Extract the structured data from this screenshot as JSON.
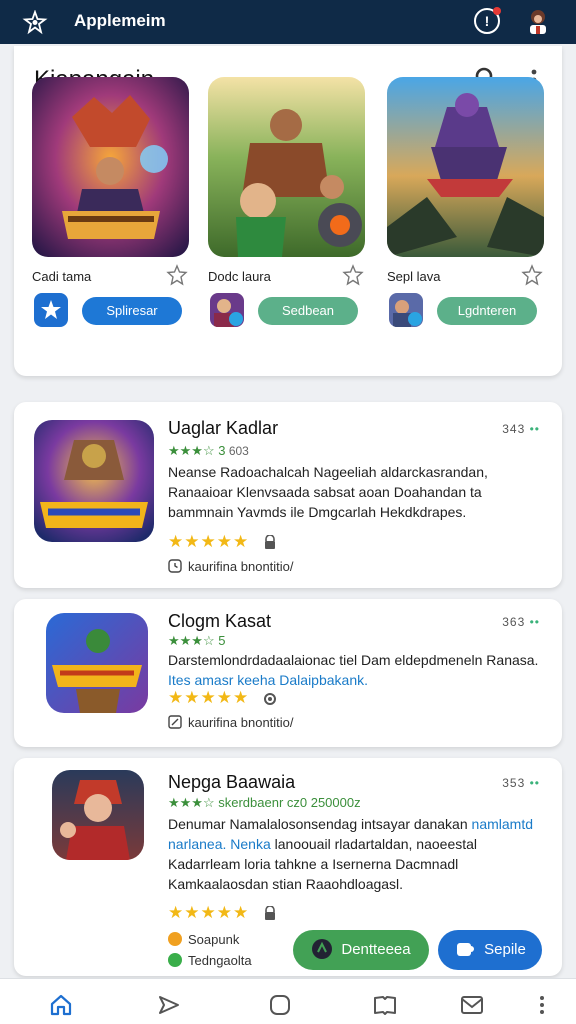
{
  "app": {
    "title": "Applemeim",
    "notification_badge": "!"
  },
  "hero": {
    "heading": "Kiapangain",
    "featured": [
      {
        "name": "Cadi tama",
        "button": "Spliresar",
        "button_color": "blue"
      },
      {
        "name": "Dodc laura",
        "button": "Sedbean",
        "button_color": "green"
      },
      {
        "name": "Sepl lava",
        "button": "Lgdnteren",
        "button_color": "green"
      }
    ]
  },
  "games": [
    {
      "title": "Uaglar Kadlar",
      "count": "343",
      "stars_text": "★★★☆ 3",
      "sub_extra": "603",
      "description": "Neanse Radoachalcah Nageeliah aldarckasrandan, Ranaaioar Klenvsaada sabsat aoan Doahandan ta bammnain Yavmds ile Dmgcarlah Hekdkdrapes.",
      "rating": "★★★★★",
      "meta": "kaurifina bnontitio/"
    },
    {
      "title": "Clogm Kasat",
      "count": "363",
      "stars_text": "★★★☆ 5",
      "sub_extra": "",
      "description_a": "Darstemlondrdadaalaionac tiel Dam eldepdmeneln Ranasa. ",
      "description_link": "Ites amasr keeha Dalaipbakank.",
      "rating": "★★★★★",
      "meta": "kaurifina bnontitio/"
    },
    {
      "title": "Nepga Baawaia",
      "count": "353",
      "stars_text": "★★★☆ skerdbaenr cz0 250000z",
      "description_a": "Denumar Namalalosonsendag intsayar danakan",
      "description_link": "namlamtd narlanea. Nenka",
      "description_b": " lanoouail rladartaldan, naoeestal Kadarrleam loria tahkne a Isernerna Dacmnadl Kamkaalaosdan stian Raaohdloagasl.",
      "rating": "★★★★★",
      "badges": [
        {
          "label": "Soapunk",
          "color": "#f0a020"
        },
        {
          "label": "Tedngaolta",
          "color": "#3aae4a"
        }
      ],
      "buttons": [
        {
          "label": "Dentteeea",
          "color": "#42a155"
        },
        {
          "label": "Sepile",
          "color": "#1e6fd0"
        }
      ]
    }
  ],
  "nav": [
    "home-icon",
    "send-icon",
    "square-icon",
    "book-icon",
    "mail-icon",
    "more-icon"
  ]
}
